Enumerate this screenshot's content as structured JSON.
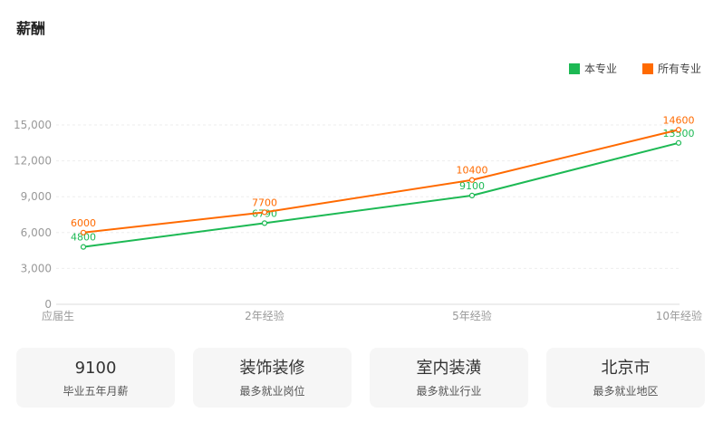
{
  "section": {
    "title": "薪酬"
  },
  "legend": [
    {
      "label": "本专业",
      "color": "#1db954"
    },
    {
      "label": "所有专业",
      "color": "#ff6a00"
    }
  ],
  "chart_data": {
    "type": "line",
    "categories": [
      "应届生",
      "2年经验",
      "5年经验",
      "10年经验"
    ],
    "series": [
      {
        "name": "本专业",
        "color": "#1db954",
        "values": [
          4800,
          6790,
          9100,
          13500
        ]
      },
      {
        "name": "所有专业",
        "color": "#ff6a00",
        "values": [
          6000,
          7700,
          10400,
          14600
        ]
      }
    ],
    "ylim": [
      0,
      15000
    ],
    "yticks": [
      0,
      3000,
      6000,
      9000,
      12000,
      15000
    ],
    "ytick_labels": [
      "0",
      "3,000",
      "6,000",
      "9,000",
      "12,000",
      "15,000"
    ],
    "grid": true,
    "legend_position": "top-right"
  },
  "stats": [
    {
      "value": "9100",
      "label": "毕业五年月薪"
    },
    {
      "value": "装饰装修",
      "label": "最多就业岗位"
    },
    {
      "value": "室内装潢",
      "label": "最多就业行业"
    },
    {
      "value": "北京市",
      "label": "最多就业地区"
    }
  ]
}
